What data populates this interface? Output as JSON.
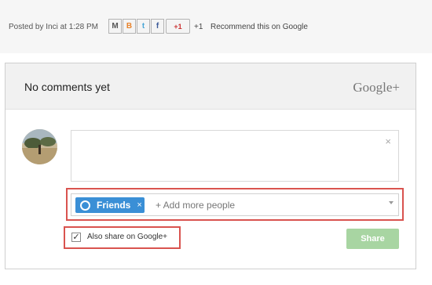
{
  "post": {
    "posted_by": "Posted by Inci at 1:28 PM",
    "share_buttons": [
      {
        "icon": "email-icon",
        "glyph": "M"
      },
      {
        "icon": "blogger-icon",
        "glyph": "B"
      },
      {
        "icon": "twitter-icon",
        "glyph": "t"
      },
      {
        "icon": "facebook-icon",
        "glyph": "f"
      }
    ],
    "gplus_button": "+1",
    "plus_count": "+1",
    "recommend": "Recommend this on Google"
  },
  "comments": {
    "header": "No comments yet",
    "brand": "Google+",
    "close_glyph": "×",
    "chip_label": "Friends",
    "chip_remove": "×",
    "add_people_placeholder": "+ Add more people",
    "also_share_label": "Also share on Google+",
    "also_share_checked": true,
    "share_label": "Share"
  }
}
